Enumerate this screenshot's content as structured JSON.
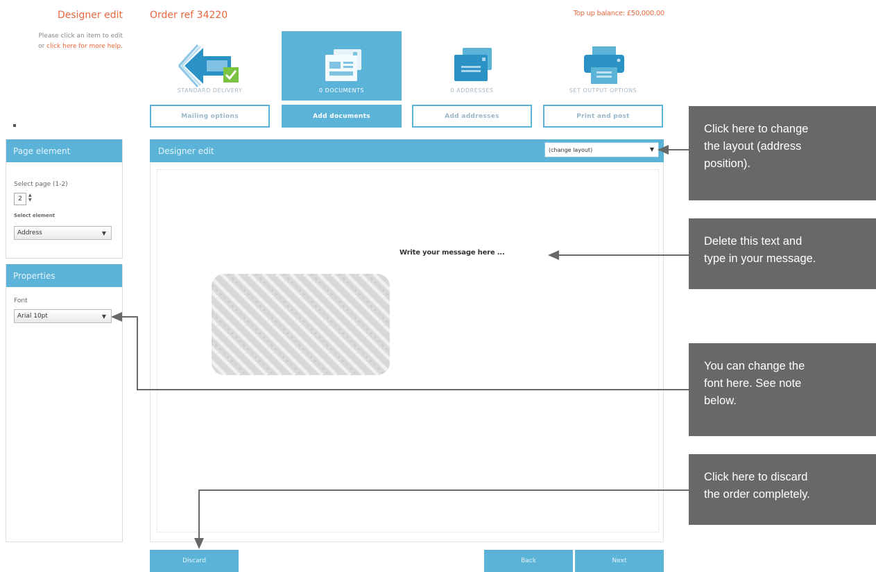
{
  "header": {
    "left_title": "Designer edit",
    "help_line1": "Please click an item to edit",
    "help_line2_prefix": "or ",
    "help_link": "click here for more help.",
    "order_ref": "Order ref 34220",
    "topup_balance": "Top up balance: £50,000.00"
  },
  "steps": [
    {
      "label": "STANDARD DELIVERY",
      "icon": "delivery-icon",
      "button": "Mailing options",
      "active": false
    },
    {
      "label": "0 DOCUMENTS",
      "icon": "documents-icon",
      "button": "Add documents",
      "active": true
    },
    {
      "label": "0 ADDRESSES",
      "icon": "addresses-icon",
      "button": "Add addresses",
      "active": false
    },
    {
      "label": "SET OUTPUT OPTIONS",
      "icon": "printer-icon",
      "button": "Print and post",
      "active": false
    }
  ],
  "page_element": {
    "title": "Page element",
    "select_page_label": "Select page (1-2)",
    "page_value": "2",
    "select_element_label": "Select element",
    "element_value": "Address"
  },
  "properties": {
    "title": "Properties",
    "font_label": "Font",
    "font_value": "Arial 10pt"
  },
  "editor": {
    "title": "Designer edit",
    "layout_select": "(change layout)",
    "message_placeholder": "Write your message here ..."
  },
  "buttons": {
    "discard": "Discard",
    "back": "Back",
    "next": "Next"
  },
  "callouts": {
    "layout": [
      "Click here to change",
      "the layout (address",
      "position)."
    ],
    "message": [
      "Delete this text and",
      "type in your message."
    ],
    "font": [
      "You can change the",
      "font here. See note",
      "below."
    ],
    "discard": [
      "Click here to discard",
      "the order completely."
    ]
  },
  "colors": {
    "accent": "#5bb3d8",
    "orange": "#e8673c",
    "callout": "#676867",
    "check_green": "#7cc243"
  }
}
